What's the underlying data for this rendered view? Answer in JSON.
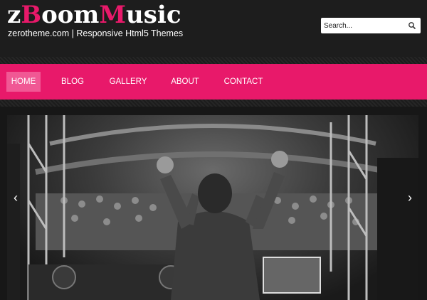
{
  "site": {
    "logo_part1": "z",
    "logo_part2": "B",
    "logo_part3": "oom",
    "logo_part4": "M",
    "logo_part5": "usic",
    "tagline": "zerotheme.com | Responsive Html5 Themes"
  },
  "search": {
    "placeholder": "Search..."
  },
  "nav": {
    "items": [
      {
        "label": "HOME",
        "active": true
      },
      {
        "label": "BLOG"
      },
      {
        "label": "GALLERY"
      },
      {
        "label": "ABOUT"
      },
      {
        "label": "CONTACT"
      }
    ]
  },
  "slider": {
    "image_name": "dj-concert-photo",
    "prev_icon": "chevron-left-icon",
    "next_icon": "chevron-right-icon"
  },
  "colors": {
    "accent": "#e8196a",
    "active_nav": "#f05894",
    "background": "#171717"
  }
}
